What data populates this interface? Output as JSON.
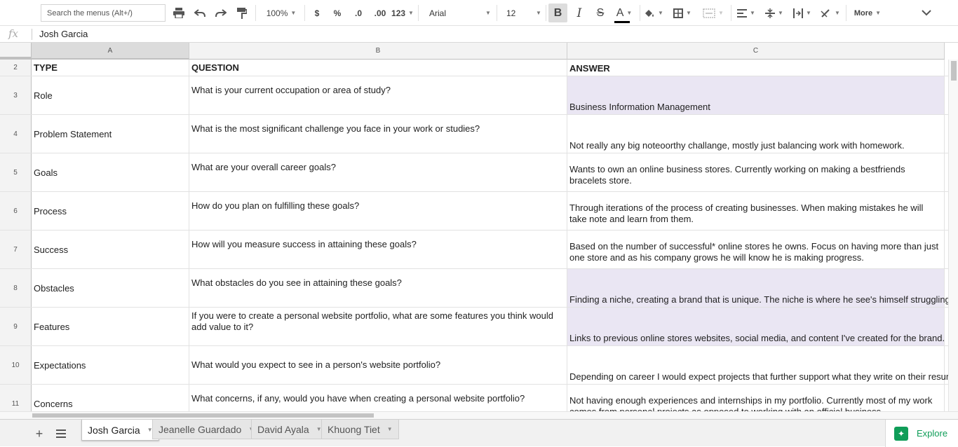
{
  "toolbar": {
    "search_placeholder": "Search the menus (Alt+/)",
    "zoom": "100%",
    "currency": "$",
    "percent": "%",
    "decrease_decimals": ".0",
    "increase_decimals": ".00",
    "more_formats": "123",
    "font": "Arial",
    "font_size": "12",
    "more": "More"
  },
  "formula_bar": {
    "fx": "fx",
    "value": "Josh Garcia"
  },
  "columns": [
    "A",
    "B",
    "C"
  ],
  "rows": [
    {
      "num": "2",
      "type": "TYPE",
      "question": "QUESTION",
      "answer": [
        "ANSWER"
      ]
    },
    {
      "num": "3",
      "type": "Role",
      "question": "What is your current occupation or area of study?",
      "answer": [
        "Business Information Management"
      ]
    },
    {
      "num": "4",
      "type": "Problem Statement",
      "question": "What is the most significant challenge you face in your work or studies?",
      "answer": [
        "Not really any big noteoorthy challange, mostly just balancing work with homework."
      ]
    },
    {
      "num": "5",
      "type": "Goals",
      "question": "What are your overall career goals?",
      "answer": [
        "Wants to own an online business stores. Currently working on making a bestfriends",
        "bracelets store."
      ]
    },
    {
      "num": "6",
      "type": "Process",
      "question": "How do you plan on fulfilling these goals?",
      "answer": [
        "Through iterations of the process of creating businesses. When making mistakes he will",
        "take note and learn from them."
      ]
    },
    {
      "num": "7",
      "type": "Success",
      "question": "How will you measure success in attaining these goals?",
      "answer": [
        "Based on the number of successful* online stores he owns. Focus on having more than just",
        "one store and as his company grows he will know he is making progress."
      ]
    },
    {
      "num": "8",
      "type": "Obstacles",
      "question": "What obstacles do you see in attaining these goals?",
      "answer": [
        "Finding a niche, creating a brand that is unique. The niche is where he see's himself struggling."
      ]
    },
    {
      "num": "9",
      "type": "Features",
      "question": "If you were to create a personal website portfolio, what are some features you think would add value to it?",
      "answer": [
        "Links to previous online stores websites, social media, and content I've created for the brand."
      ]
    },
    {
      "num": "10",
      "type": "Expectations",
      "question": "What would you expect to see in a person's website portfolio?",
      "answer": [
        "Depending on career I would expect projects that further support what they write on their resum"
      ]
    },
    {
      "num": "11",
      "type": "Concerns",
      "question": "What concerns, if any, would you have when creating a personal website portfolio?",
      "answer": [
        "Not having enough experiences and internships in my portfolio. Currently most of my work",
        "comes from personal projects as opposed to working with an official business."
      ]
    }
  ],
  "sheets": [
    "Josh Garcia",
    "Jeanelle Guardado",
    "David Ayala",
    "Khuong Tiet"
  ],
  "explore": "Explore",
  "colors": {
    "accent": "#0f9d58",
    "highlight": "#eae6f3"
  }
}
